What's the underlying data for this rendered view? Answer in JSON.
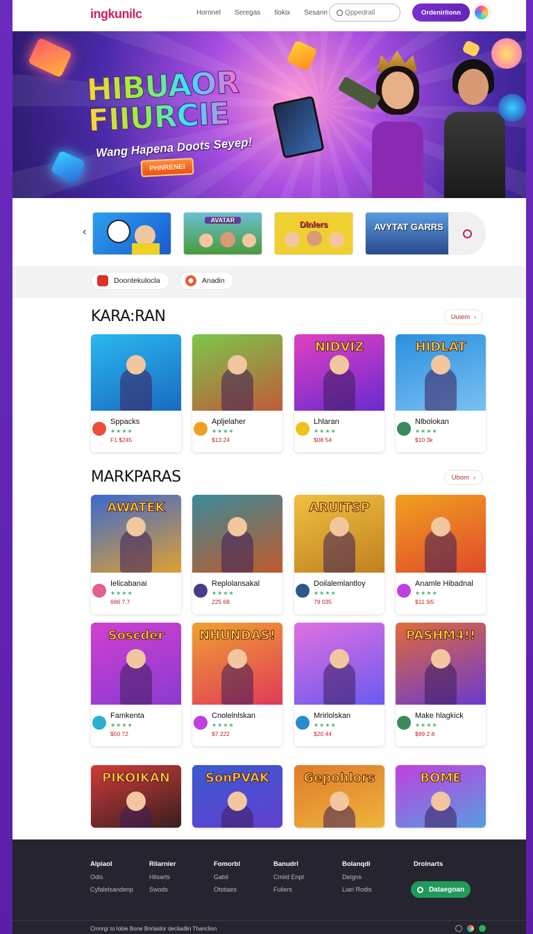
{
  "header": {
    "logo": "ingkunilc",
    "nav": [
      "Hornnel",
      "Seregas",
      "Ilokix",
      "Sesann"
    ],
    "search_placeholder": "Qppedrall",
    "cta_label": "Ordenirlionn"
  },
  "hero": {
    "title_line1": "HIBUAOR",
    "title_line2": "FIIURCIE",
    "subtitle": "Wang Hapena  Doots Seyep!",
    "button_label": "PHNRENEI"
  },
  "carousel": {
    "tiles": [
      "",
      "AVATAR",
      "Dlnlers",
      "AVYTAT GARRS"
    ]
  },
  "filters": [
    {
      "label": "Doontekulocla",
      "color": "#e0302a"
    },
    {
      "label": "Anadin",
      "color": "#e85a3a"
    }
  ],
  "sections": [
    {
      "title": "KARA:RAN",
      "see_all": "Uuiem",
      "cards": [
        {
          "name": "Sppacks",
          "price": "F1 $245",
          "stars": "★★★★",
          "art": "",
          "bg1": "#2ab8f0",
          "bg2": "#1a6ac0",
          "icon": "#e8503a"
        },
        {
          "name": "Apljelaher",
          "price": "$13 24",
          "stars": "★★★★",
          "art": "",
          "bg1": "#7ac84a",
          "bg2": "#c05a3a",
          "icon": "#f0a020"
        },
        {
          "name": "Lhlaran",
          "price": "$08 54",
          "stars": "★★★★",
          "art": "NIDVIZ",
          "bg1": "#e040c0",
          "bg2": "#6a2ad0",
          "icon": "#f0c020"
        },
        {
          "name": "Nlbolokan",
          "price": "$10 3k",
          "stars": "★★★★",
          "art": "HIDLAT",
          "bg1": "#2a90e0",
          "bg2": "#7ac0f0",
          "icon": "#3a8a5a"
        }
      ]
    },
    {
      "title": "MARKPARAS",
      "see_all": "Ubom",
      "cards": [
        {
          "name": "Ielicabanai",
          "price": "696 7.7",
          "stars": "★★★★",
          "art": "AWATEK",
          "bg1": "#3a6ad0",
          "bg2": "#e0a030",
          "icon": "#e06090"
        },
        {
          "name": "Replolansakal",
          "price": "225 68",
          "stars": "★★★★",
          "art": "",
          "bg1": "#3a8a9a",
          "bg2": "#c05a2a",
          "icon": "#4a3a8a"
        },
        {
          "name": "Doilalemlantloy",
          "price": "79 035",
          "stars": "★★★★",
          "art": "ARUITSP",
          "bg1": "#f0c040",
          "bg2": "#c08020",
          "icon": "#2a5a8a"
        },
        {
          "name": "Anamle Hibadnal",
          "price": "$11 3i5",
          "stars": "★★★★",
          "art": "",
          "bg1": "#f0a020",
          "bg2": "#e04a2a",
          "icon": "#c040e0"
        }
      ]
    },
    {
      "title": "",
      "see_all": "",
      "cards": [
        {
          "name": "Famkenta",
          "price": "$50 72",
          "stars": "★★★★",
          "art": "Soscder",
          "bg1": "#d040d0",
          "bg2": "#8a3ad0",
          "icon": "#2ab0d0"
        },
        {
          "name": "Cnolelnlskan",
          "price": "$7 222",
          "stars": "★★★★",
          "art": "NHUNDAS!",
          "bg1": "#f0a030",
          "bg2": "#e03a5a",
          "icon": "#c040e0"
        },
        {
          "name": "Mrirlolskan",
          "price": "$20 44",
          "stars": "★★★★",
          "art": "",
          "bg1": "#e070e0",
          "bg2": "#6a5af0",
          "icon": "#2a8ad0"
        },
        {
          "name": "Make hlagkick",
          "price": "$99 2.8",
          "stars": "★★★★",
          "art": "PASHM4!!",
          "bg1": "#e06a3a",
          "bg2": "#6a3ad0",
          "icon": "#3a8a5a"
        }
      ]
    },
    {
      "title": "",
      "see_all": "",
      "cards": [
        {
          "name": "",
          "price": "",
          "stars": "",
          "art": "PIKOIKAN",
          "bg1": "#d03a3a",
          "bg2": "#1a1a1a",
          "icon": "#000"
        },
        {
          "name": "",
          "price": "",
          "stars": "",
          "art": "SonPVAK",
          "bg1": "#3a5ad0",
          "bg2": "#6a3ad0",
          "icon": "#000"
        },
        {
          "name": "",
          "price": "",
          "stars": "",
          "art": "Gepohlors",
          "bg1": "#e07a2a",
          "bg2": "#f0c040",
          "icon": "#000"
        },
        {
          "name": "",
          "price": "",
          "stars": "",
          "art": "BOME",
          "bg1": "#c040e0",
          "bg2": "#40b0e0",
          "icon": "#000"
        }
      ]
    }
  ],
  "footer": {
    "cols": [
      {
        "h": "Alpiaol",
        "items": [
          "Odis",
          "Cyfalelsandenp"
        ]
      },
      {
        "h": "Rilarnier",
        "items": [
          "Hilsarts",
          "Swods"
        ]
      },
      {
        "h": "Fomorbl",
        "items": [
          "Gabil",
          "Otstiaes"
        ]
      },
      {
        "h": "Banudrl",
        "items": [
          "Cmiid Enpt",
          "Fuliers"
        ]
      },
      {
        "h": "Bolanqdi",
        "items": [
          "Deigns",
          "Liari Rodis"
        ]
      },
      {
        "h": "Drolnarts",
        "items": []
      }
    ],
    "button_label": "Dataegoan",
    "copyright": "Cmnrgr to  lobie  Bone  Bnrlaidor decliadlin  Thanclion"
  }
}
